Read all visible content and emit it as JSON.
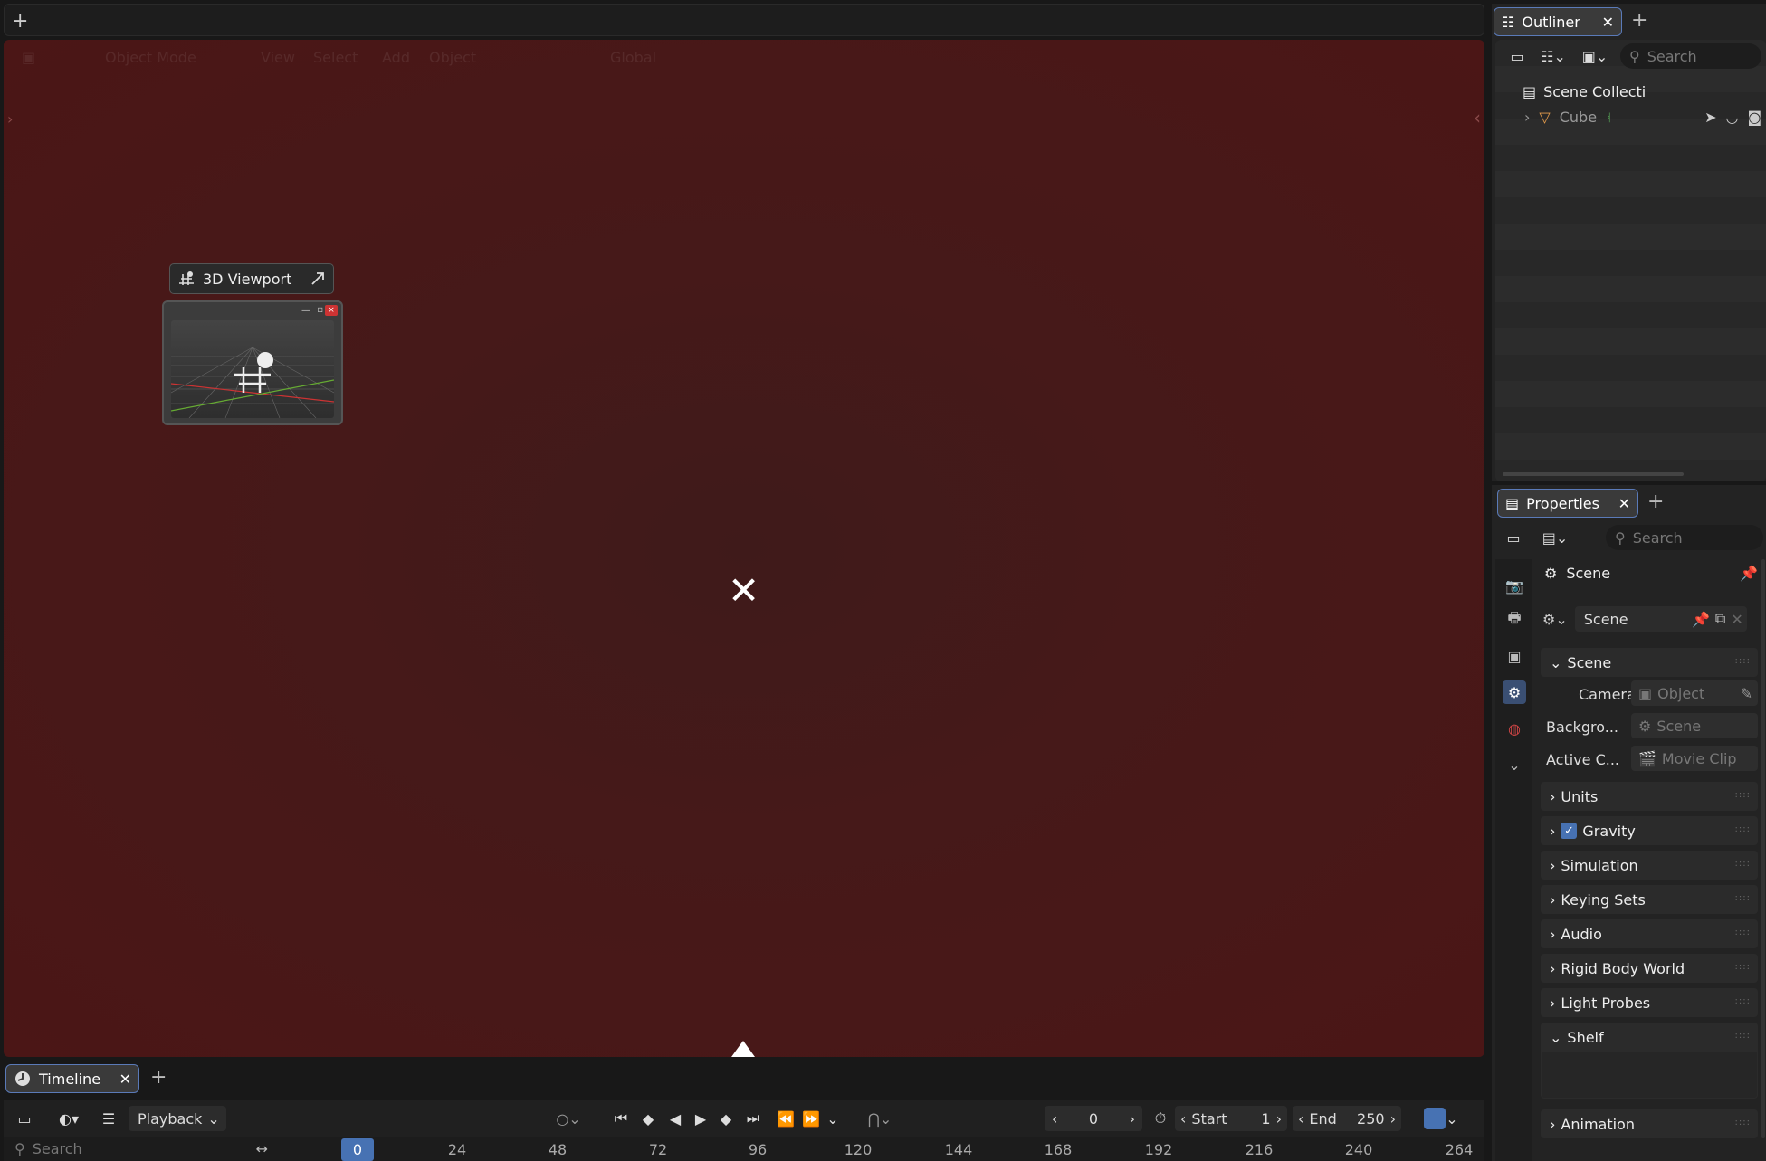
{
  "topbar": {
    "add_label": "+"
  },
  "viewport": {
    "header": {
      "mode": "Object Mode",
      "menu": [
        "View",
        "Select",
        "Add",
        "Object"
      ],
      "orientation": "Global"
    },
    "drag_tooltip": {
      "label": "3D Viewport"
    },
    "center_glyph": "✕"
  },
  "timeline": {
    "tab_label": "Timeline",
    "add_tab": "+",
    "playback_label": "Playback",
    "current_frame": "0",
    "start_label": "Start",
    "start_value": "1",
    "end_label": "End",
    "end_value": "250",
    "search_placeholder": "Search",
    "ruler": [
      "0",
      "24",
      "48",
      "72",
      "96",
      "120",
      "144",
      "168",
      "192",
      "216",
      "240",
      "264"
    ],
    "current_marker": "0"
  },
  "outliner": {
    "tab_label": "Outliner",
    "add_tab": "+",
    "search_placeholder": "Search",
    "rows": [
      {
        "label": "Scene Collecti"
      },
      {
        "label": "Cube"
      }
    ]
  },
  "properties": {
    "tab_label": "Properties",
    "add_tab": "+",
    "search_placeholder": "Search",
    "context_title": "Scene",
    "datablock_name": "Scene",
    "scene_panel": {
      "title": "Scene",
      "camera_label": "Camera",
      "camera_value": "Object",
      "background_label": "Backgro...",
      "background_value": "Scene",
      "active_clip_label": "Active C...",
      "active_clip_value": "Movie Clip"
    },
    "panels": [
      "Units",
      "Gravity",
      "Simulation",
      "Keying Sets",
      "Audio",
      "Rigid Body World",
      "Light Probes",
      "Shelf",
      "Animation"
    ],
    "gravity_checked": true
  },
  "colors": {
    "accent": "#4772b3",
    "viewport_tint": "#461919",
    "tab_border": "#5a7ab8"
  }
}
